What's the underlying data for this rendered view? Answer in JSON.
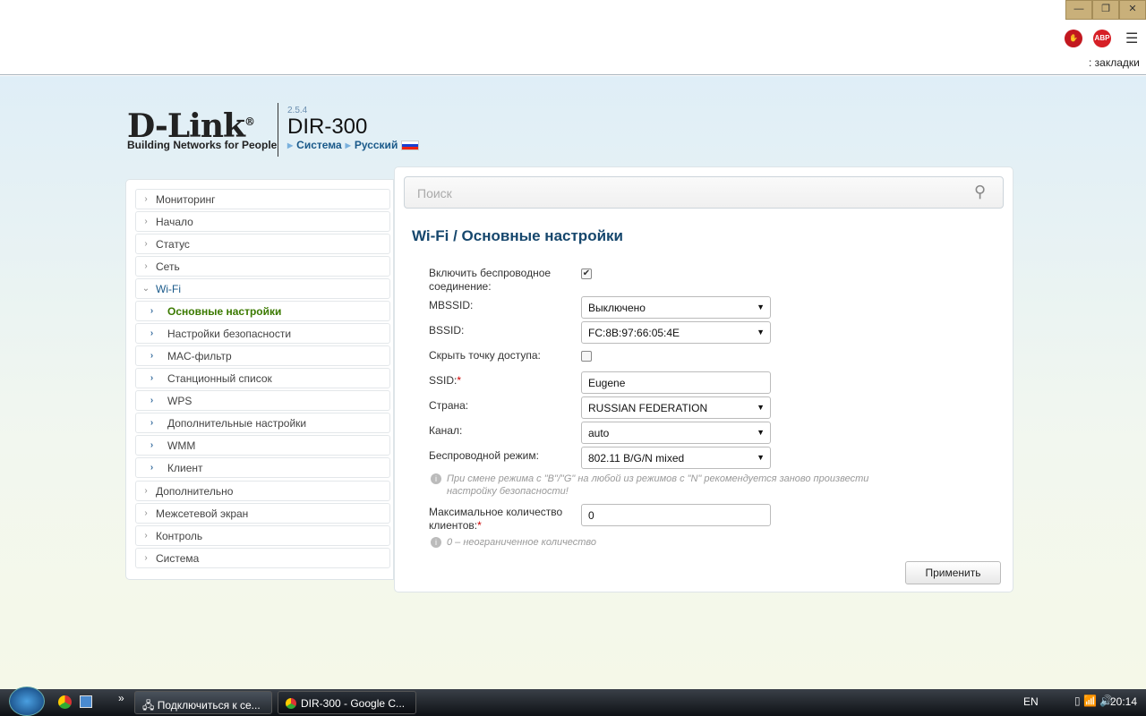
{
  "browser": {
    "bookmarks_text": ": закладки",
    "win_buttons": [
      "—",
      "❐",
      "✕"
    ],
    "extensions": [
      "stop",
      "ABP"
    ]
  },
  "header": {
    "logo": "D-Link",
    "registered": "®",
    "tagline": "Building Networks for People",
    "version": "2.5.4",
    "model": "DIR-300",
    "crumbs": [
      "Система",
      "Русский"
    ]
  },
  "sidebar": {
    "items": [
      {
        "label": "Мониторинг",
        "type": "top"
      },
      {
        "label": "Начало",
        "type": "top"
      },
      {
        "label": "Статус",
        "type": "top"
      },
      {
        "label": "Сеть",
        "type": "top"
      },
      {
        "label": "Wi-Fi",
        "type": "open"
      },
      {
        "label": "Основные настройки",
        "type": "active"
      },
      {
        "label": "Настройки безопасности",
        "type": "sub"
      },
      {
        "label": "MAC-фильтр",
        "type": "sub"
      },
      {
        "label": "Станционный список",
        "type": "sub"
      },
      {
        "label": "WPS",
        "type": "sub"
      },
      {
        "label": "Дополнительные настройки",
        "type": "sub"
      },
      {
        "label": "WMM",
        "type": "sub"
      },
      {
        "label": "Клиент",
        "type": "sub"
      },
      {
        "label": "Дополнительно",
        "type": "top"
      },
      {
        "label": "Межсетевой экран",
        "type": "top"
      },
      {
        "label": "Контроль",
        "type": "top"
      },
      {
        "label": "Система",
        "type": "top"
      }
    ]
  },
  "search": {
    "placeholder": "Поиск"
  },
  "main": {
    "title": "Wi-Fi /  Основные настройки",
    "enable_label": "Включить беспроводное соединение:",
    "enable_checked": true,
    "mbssid_label": "MBSSID:",
    "mbssid": "Выключено",
    "bssid_label": "BSSID:",
    "bssid": "FC:8B:97:66:05:4E",
    "hide_label": "Скрыть точку доступа:",
    "hide_checked": false,
    "ssid_label": "SSID:",
    "ssid": "Eugene",
    "country_label": "Страна:",
    "country": "RUSSIAN FEDERATION",
    "channel_label": "Канал:",
    "channel": "auto",
    "mode_label": "Беспроводной режим:",
    "mode": "802.11 B/G/N mixed",
    "mode_hint": "При смене режима с \"B\"/\"G\" на любой из режимов с \"N\" рекомендуется заново произвести настройку безопасности!",
    "maxclients_label": "Максимальное количество клиентов:",
    "maxclients": "0",
    "maxclients_hint": "0 – неограниченное количество",
    "required_mark": "*",
    "apply": "Применить"
  },
  "taskbar": {
    "overflow": "»",
    "tasks": [
      "Подключиться к се...",
      "DIR-300 - Google C..."
    ],
    "lang": "EN",
    "time": "20:14"
  }
}
